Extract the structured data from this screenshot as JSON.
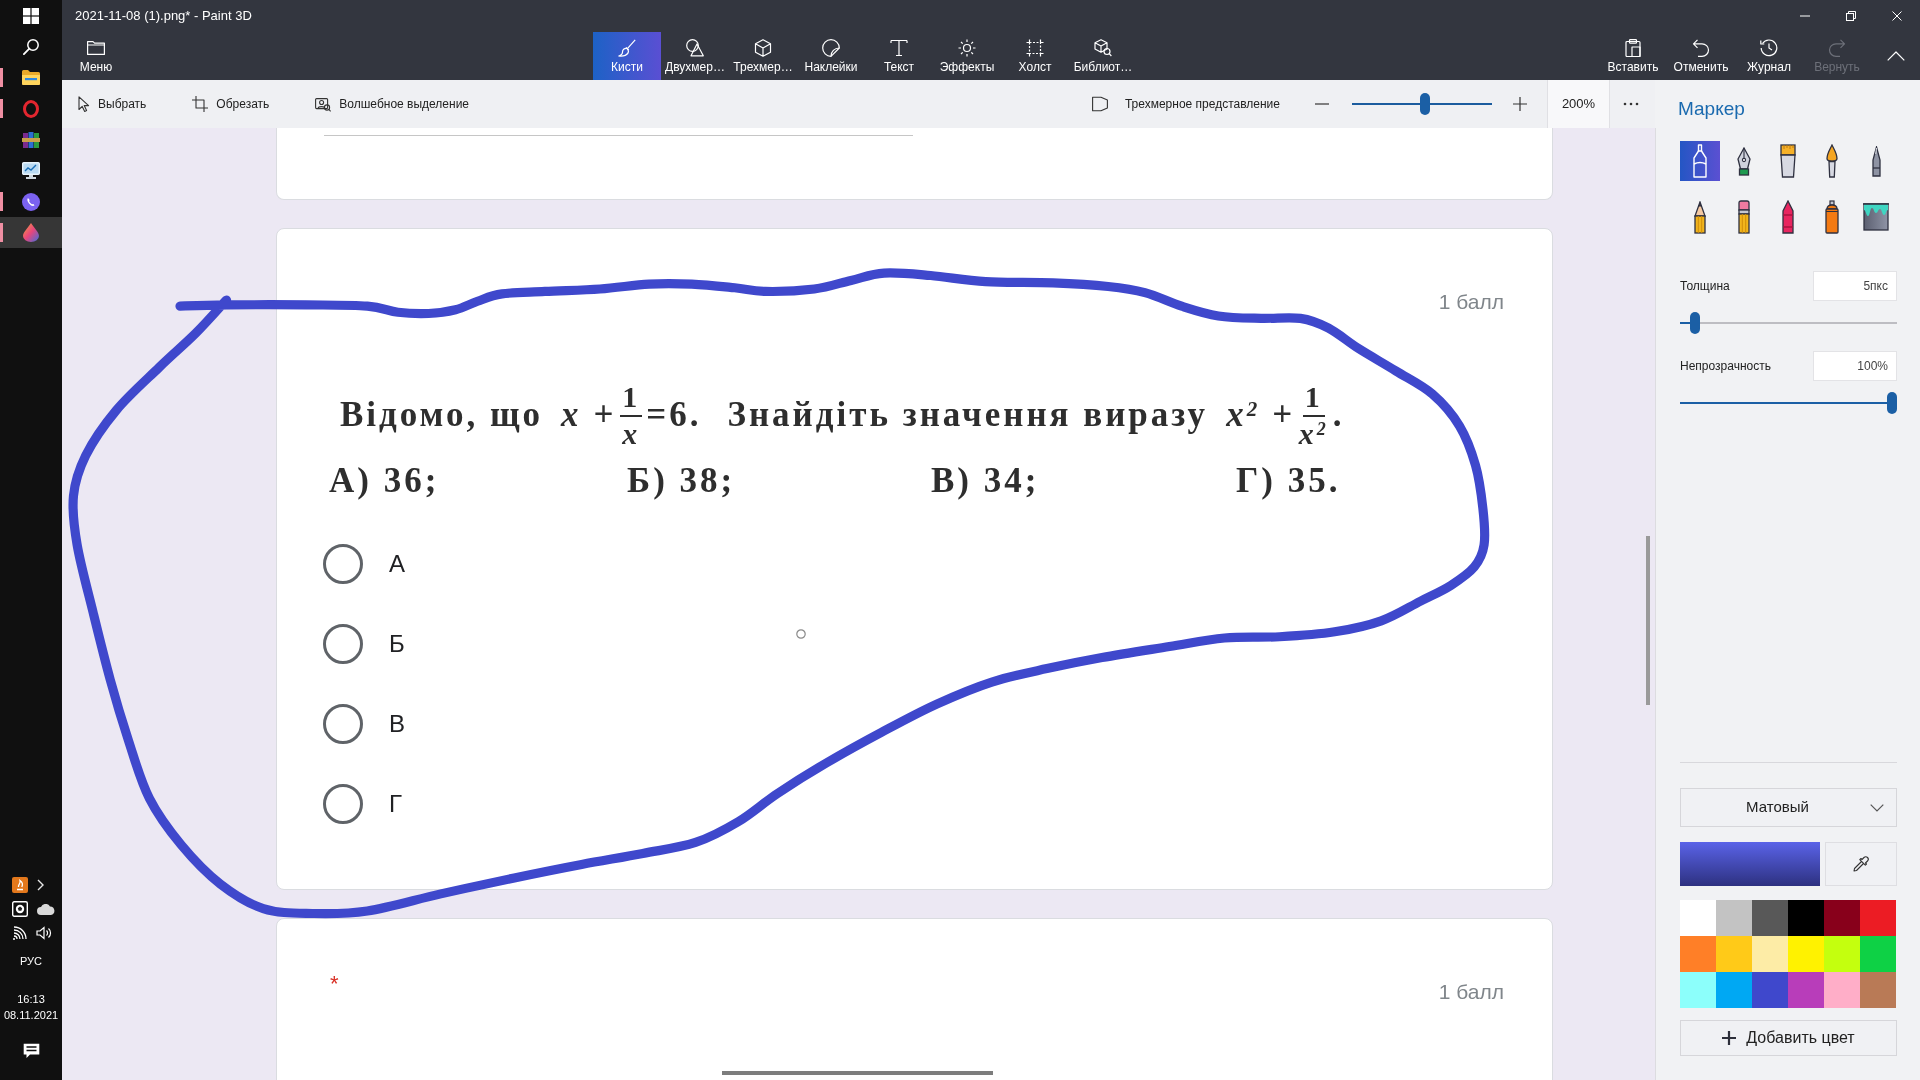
{
  "taskbar": {
    "apps": [
      {
        "running": true,
        "active": false
      },
      {
        "running": true,
        "active": false
      },
      {
        "running": false,
        "active": false
      },
      {
        "running": false,
        "active": false
      },
      {
        "running": true,
        "active": false
      },
      {
        "running": true,
        "active": true
      }
    ],
    "language": "РУС",
    "time": "16:13",
    "date": "08.11.2021"
  },
  "window": {
    "title": "2021-11-08 (1).png* - Paint 3D"
  },
  "menu": {
    "label": "Меню"
  },
  "tabs": [
    {
      "label": "Кисти",
      "selected": true
    },
    {
      "label": "Двухмер…",
      "selected": false
    },
    {
      "label": "Трехмер…",
      "selected": false
    },
    {
      "label": "Наклейки",
      "selected": false
    },
    {
      "label": "Текст",
      "selected": false
    },
    {
      "label": "Эффекты",
      "selected": false
    },
    {
      "label": "Холст",
      "selected": false
    },
    {
      "label": "Библиот…",
      "selected": false
    }
  ],
  "actions": [
    {
      "label": "Вставить",
      "disabled": false
    },
    {
      "label": "Отменить",
      "disabled": false
    },
    {
      "label": "Журнал",
      "disabled": false
    },
    {
      "label": "Вернуть",
      "disabled": true
    }
  ],
  "tools": [
    {
      "label": "Выбрать"
    },
    {
      "label": "Обрезать"
    },
    {
      "label": "Волшебное выделение"
    }
  ],
  "view_3d": {
    "label": "Трехмерное представление"
  },
  "zoom": {
    "level": 0.52,
    "value": "200%"
  },
  "canvas": {
    "cards": [
      {
        "kind": "field"
      },
      {
        "kind": "question",
        "points": "1 балл",
        "question": {
          "line": [
            {
              "kind": "text",
              "text": "Відомо, що"
            },
            {
              "kind": "math",
              "text": "x +"
            },
            {
              "kind": "fraction",
              "numerator": "1",
              "denominator": "x"
            },
            {
              "kind": "text",
              "text": "=6."
            },
            {
              "kind": "text",
              "text": "Знайдіть значення виразу"
            },
            {
              "kind": "math",
              "text": "x$^{2}$ +"
            },
            {
              "kind": "fraction",
              "numerator": "1",
              "denominator": "x$^{2}$"
            },
            {
              "kind": "text",
              "text": "."
            }
          ],
          "choices": [
            "А) 36;",
            "Б) 38;",
            "В) 34;",
            "Г) 35."
          ]
        },
        "options": [
          {
            "label": "А",
            "selected": false
          },
          {
            "label": "Б",
            "selected": false
          },
          {
            "label": "В",
            "selected": false
          },
          {
            "label": "Г",
            "selected": false
          }
        ]
      },
      {
        "kind": "question",
        "required_mark": "*",
        "points": "1 балл"
      }
    ]
  },
  "side_panel": {
    "title": "Маркер",
    "brushes": [
      {
        "selected": true
      },
      {
        "selected": false
      },
      {
        "selected": false
      },
      {
        "selected": false
      },
      {
        "selected": false
      },
      {
        "selected": false
      },
      {
        "selected": false
      },
      {
        "selected": false
      },
      {
        "selected": false
      },
      {
        "selected": false
      }
    ],
    "thickness": {
      "label": "Толщина",
      "value": "5пкс",
      "level": 0.05
    },
    "opacity": {
      "label": "Непрозрачность",
      "value": "100%",
      "level": 1
    },
    "finish": "Матовый",
    "palette": [
      {
        "color": "#ffffff"
      },
      {
        "color": "#c3c3c3"
      },
      {
        "color": "#585858"
      },
      {
        "color": "#000000"
      },
      {
        "color": "#88001b"
      },
      {
        "color": "#ec1c24"
      },
      {
        "color": "#ff7f27"
      },
      {
        "color": "#ffca18"
      },
      {
        "color": "#fdeca6"
      },
      {
        "color": "#fff200"
      },
      {
        "color": "#c4ff0e"
      },
      {
        "color": "#0ed145"
      },
      {
        "color": "#8cfffb"
      },
      {
        "color": "#00a8f3"
      },
      {
        "color": "#3f48cc"
      },
      {
        "color": "#b83dba"
      },
      {
        "color": "#ffaec8"
      },
      {
        "color": "#b97a56"
      }
    ],
    "add_color": "Добавить цвет"
  }
}
